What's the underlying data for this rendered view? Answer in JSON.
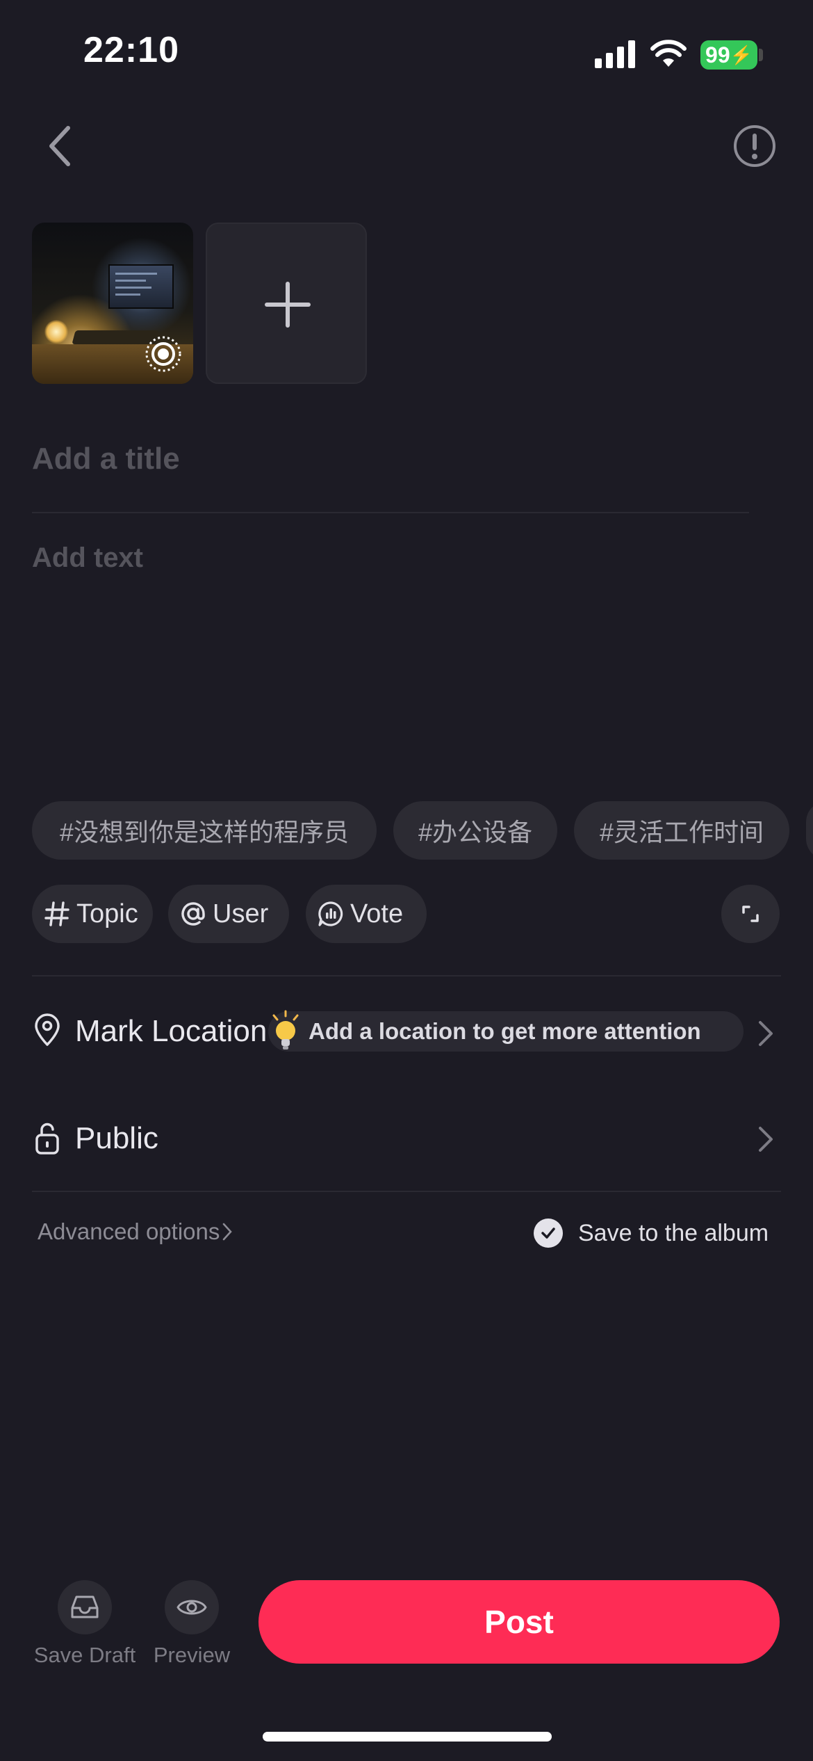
{
  "status_bar": {
    "time": "22:10",
    "battery": "99"
  },
  "media": {
    "live_badge": "live-photo-icon"
  },
  "form": {
    "title_placeholder": "Add a title",
    "text_placeholder": "Add text"
  },
  "suggested_topics": [
    "#没想到你是这样的程序员",
    "#办公设备",
    "#灵活工作时间"
  ],
  "tools": {
    "topic": "Topic",
    "user": "User",
    "vote": "Vote"
  },
  "location": {
    "label": "Mark Location",
    "hint": "Add a location to get more attention"
  },
  "privacy": {
    "label": "Public"
  },
  "options": {
    "advanced": "Advanced options",
    "save_album": "Save to the album",
    "save_album_checked": true
  },
  "bottom": {
    "save_draft": "Save Draft",
    "preview": "Preview",
    "post": "Post"
  },
  "colors": {
    "background": "#1c1b24",
    "post_button": "#fe2c55",
    "battery": "#34c759"
  }
}
